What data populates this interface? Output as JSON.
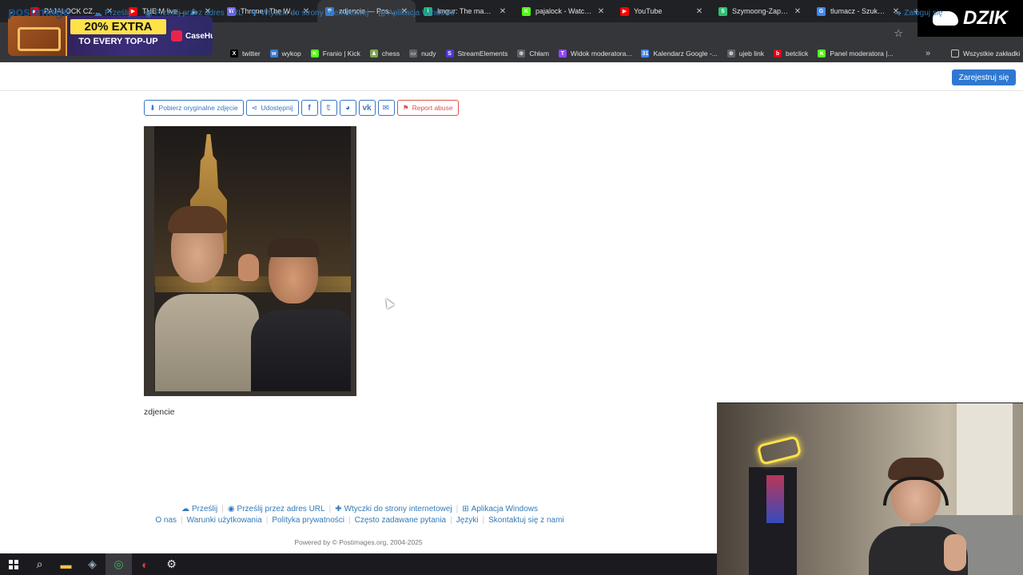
{
  "tabs": [
    {
      "title": "PAJALOCK CZYLI PAT",
      "color": "#ff0000",
      "glyph": "▶",
      "active": false
    },
    {
      "title": "THE M live at SP",
      "color": "#ff0000",
      "glyph": "▶",
      "active": false,
      "audio": true
    },
    {
      "title": "Throne | The Wishlist",
      "color": "#7b5cff",
      "glyph": "W",
      "active": false
    },
    {
      "title": "zdjencie — Postimag",
      "color": "#3b7bd6",
      "glyph": "P",
      "active": true
    },
    {
      "title": "Imgur: The magic of t",
      "color": "#1bb76e",
      "glyph": "i",
      "active": false
    },
    {
      "title": "pajalock - Watch clip",
      "color": "#53fc18",
      "glyph": "K",
      "active": false
    },
    {
      "title": "YouTube",
      "color": "#ff0000",
      "glyph": "▶",
      "active": false
    },
    {
      "title": "Szymoong-Zapamięt",
      "color": "#2fbf71",
      "glyph": "S",
      "active": false
    },
    {
      "title": "tlumacz - Szukaj w G",
      "color": "#4285f4",
      "glyph": "G",
      "active": false
    }
  ],
  "bookmarks": [
    {
      "label": "twitter",
      "color": "#000000",
      "glyph": "X"
    },
    {
      "label": "wykop",
      "color": "#3b7bd6",
      "glyph": "w"
    },
    {
      "label": "Franio | Kick",
      "color": "#53fc18",
      "glyph": "K"
    },
    {
      "label": "chess",
      "color": "#7fa650",
      "glyph": "♟"
    },
    {
      "label": "nudy",
      "color": "#5f6368",
      "glyph": "▭"
    },
    {
      "label": "StreamElements",
      "color": "#4e3ad8",
      "glyph": "S"
    },
    {
      "label": "Chłam",
      "color": "#5f6368",
      "glyph": "⊕"
    },
    {
      "label": "Widok moderatora...",
      "color": "#9146ff",
      "glyph": "T"
    },
    {
      "label": "Kalendarz Google -...",
      "color": "#4285f4",
      "glyph": "31"
    },
    {
      "label": "ujeb link",
      "color": "#5f6368",
      "glyph": "⊕"
    },
    {
      "label": "betclick",
      "color": "#e2001a",
      "glyph": "b"
    },
    {
      "label": "Panel moderatora |...",
      "color": "#53fc18",
      "glyph": "K"
    }
  ],
  "bookmarks_all": "Wszystkie zakładki",
  "ad": {
    "line1": "20% EXTRA",
    "line2": "TO EVERY TOP-UP",
    "brand": "CaseHug"
  },
  "dzik": "DZIK",
  "postimage": {
    "logo": "postimage",
    "nav": [
      {
        "label": "Prześlij",
        "icon": "upload-icon",
        "glyph": "☁"
      },
      {
        "label": "Prześlij przez adres URL",
        "icon": "globe-icon",
        "glyph": "◉"
      },
      {
        "label": "Wtyczki do strony internetowej",
        "icon": "puzzle-icon",
        "glyph": "✚"
      },
      {
        "label": "Aplikacja Windows",
        "icon": "windows-icon",
        "glyph": "⊞"
      }
    ],
    "login": "Zaloguj się",
    "signup": "Zarejestruj się"
  },
  "actions": {
    "download": "Pobierz oryginalne zdjęcie",
    "share": "Udostępnij",
    "report": "Report abuse"
  },
  "image_caption": "zdjencie",
  "footer": {
    "nav": [
      "Prześlij",
      "Prześlij przez adres URL",
      "Wtyczki do strony internetowej",
      "Aplikacja Windows"
    ],
    "links": [
      "O nas",
      "Warunki użytkowania",
      "Polityka prywatności",
      "Często zadawane pytania",
      "Języki",
      "Skontaktuj się z nami"
    ],
    "powered": "Powered by © Postimages.org, 2004-2025"
  }
}
